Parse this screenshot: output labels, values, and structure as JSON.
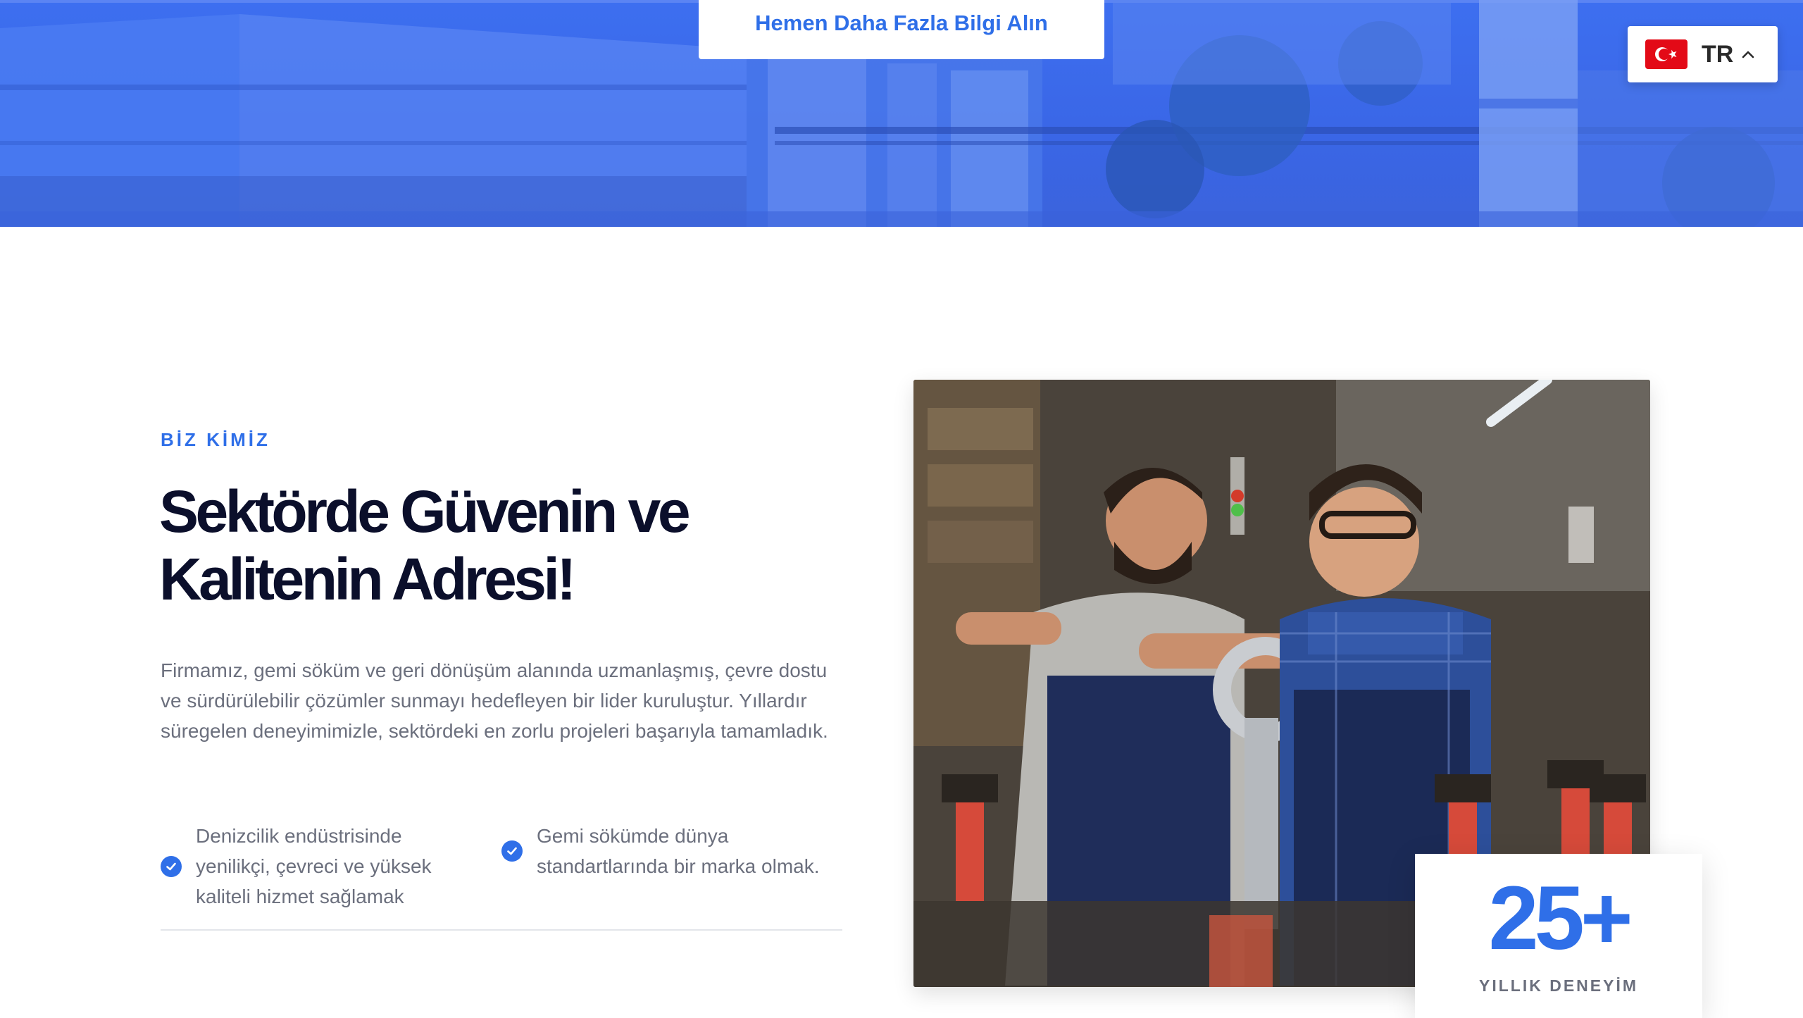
{
  "hero": {
    "cta_label": "Hemen Daha Fazla Bilgi Alın",
    "accent": "#2f6fe8"
  },
  "language": {
    "code": "TR",
    "flag_icon": "turkey-flag-icon",
    "toggle_icon": "chevron-up-icon"
  },
  "about": {
    "eyebrow": "BİZ KİMİZ",
    "headline_line1": "Sektörde Güvenin ve",
    "headline_line2": "Kalitenin Adresi!",
    "description": "Firmamız, gemi söküm ve geri dönüşüm alanında uzmanlaşmış, çevre dostu ve sürdürülebilir çözümler sunmayı hedefleyen bir lider kuruluştur. Yıllardır süregelen deneyimimizle, sektördeki en zorlu projeleri başarıyla tamamladık.",
    "features": [
      {
        "icon": "check-circle-icon",
        "text": "Denizcilik endüstrisinde yenilikçi, çevreci ve yüksek kaliteli hizmet sağlamak"
      },
      {
        "icon": "check-circle-icon",
        "text": "Gemi sökümde dünya standartlarında bir marka olmak."
      }
    ]
  },
  "experience": {
    "value": "25+",
    "label": "YILLIK DENEYİM"
  },
  "colors": {
    "primary": "#2f6fe8",
    "heading": "#0b0f2b",
    "body": "#6b6f7d",
    "hero_tint": "#3d6ff0"
  }
}
